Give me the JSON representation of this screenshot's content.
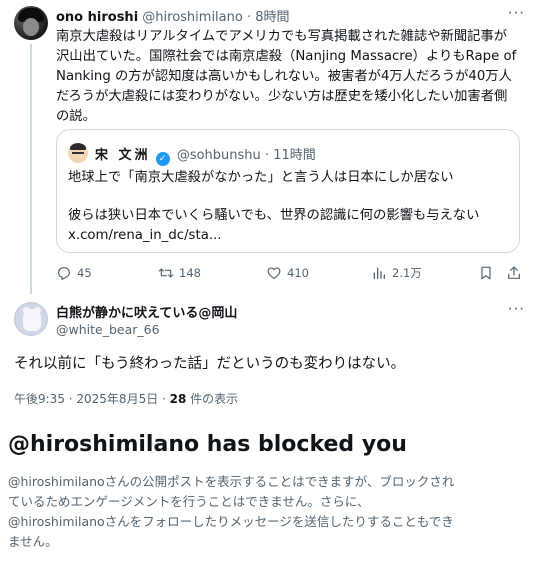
{
  "tweet": {
    "author_name": "ono hiroshi",
    "author_handle": "@hiroshimilano",
    "separator": "·",
    "time": "8時間",
    "more": "···",
    "text_lines": [
      "南京大虐殺はリアルタイムでアメリカでも写真掲載された雑誌や新聞記事が",
      "沢山出ていた。国際社会では南京虐殺（Nanjing Massacre）よりもRape of",
      "Nanking の方が認知度は高いかもしれない。被害者が4万人だろうが40万人",
      "だろうが大虐殺には変わりがない。少ない方は歴史を矮小化したい加害者側",
      "の説。"
    ],
    "quote": {
      "author_name": "宋 文洲",
      "author_handle": "@sohbunshu",
      "separator": "·",
      "time": "11時間",
      "line1": "地球上で「南京大虐殺がなかった」と言う人は日本にしか居ない",
      "line2": "彼らは狭い日本でいくら騒いでも、世界の認識に何の影響も与えない",
      "link": "x.com/rena_in_dc/sta..."
    },
    "actions": {
      "replies": "45",
      "reposts": "148",
      "likes": "410",
      "views": "2.1万"
    }
  },
  "reply": {
    "author_name": "白熊が静かに吠えている@岡山",
    "author_handle": "@white_bear_66",
    "more": "···",
    "text": "それ以前に「もう終わった話」だというのも変わりはない。",
    "timestamp": "午後9:35 · 2025年8月5日 · ",
    "views_count": "28",
    "views_label": " 件の表示"
  },
  "block": {
    "title": "@hiroshimilano has blocked you",
    "desc_lines": [
      "@hiroshimilanoさんの公開ポストを表示することはできますが、ブロックされ",
      "ているためエンゲージメントを行うことはできません。さらに、",
      "@hiroshimilanoさんをフォローしたりメッセージを送信したりすることもでき",
      "ません。"
    ]
  },
  "colors": {
    "text_primary": "#0f1419",
    "text_secondary": "#536471",
    "border": "#cfd9de",
    "verified": "#1d9bf0"
  },
  "icons": {
    "reply": "reply-icon",
    "repost": "repost-icon",
    "like": "heart-icon",
    "views": "views-icon",
    "bookmark": "bookmark-icon",
    "share": "share-icon"
  }
}
